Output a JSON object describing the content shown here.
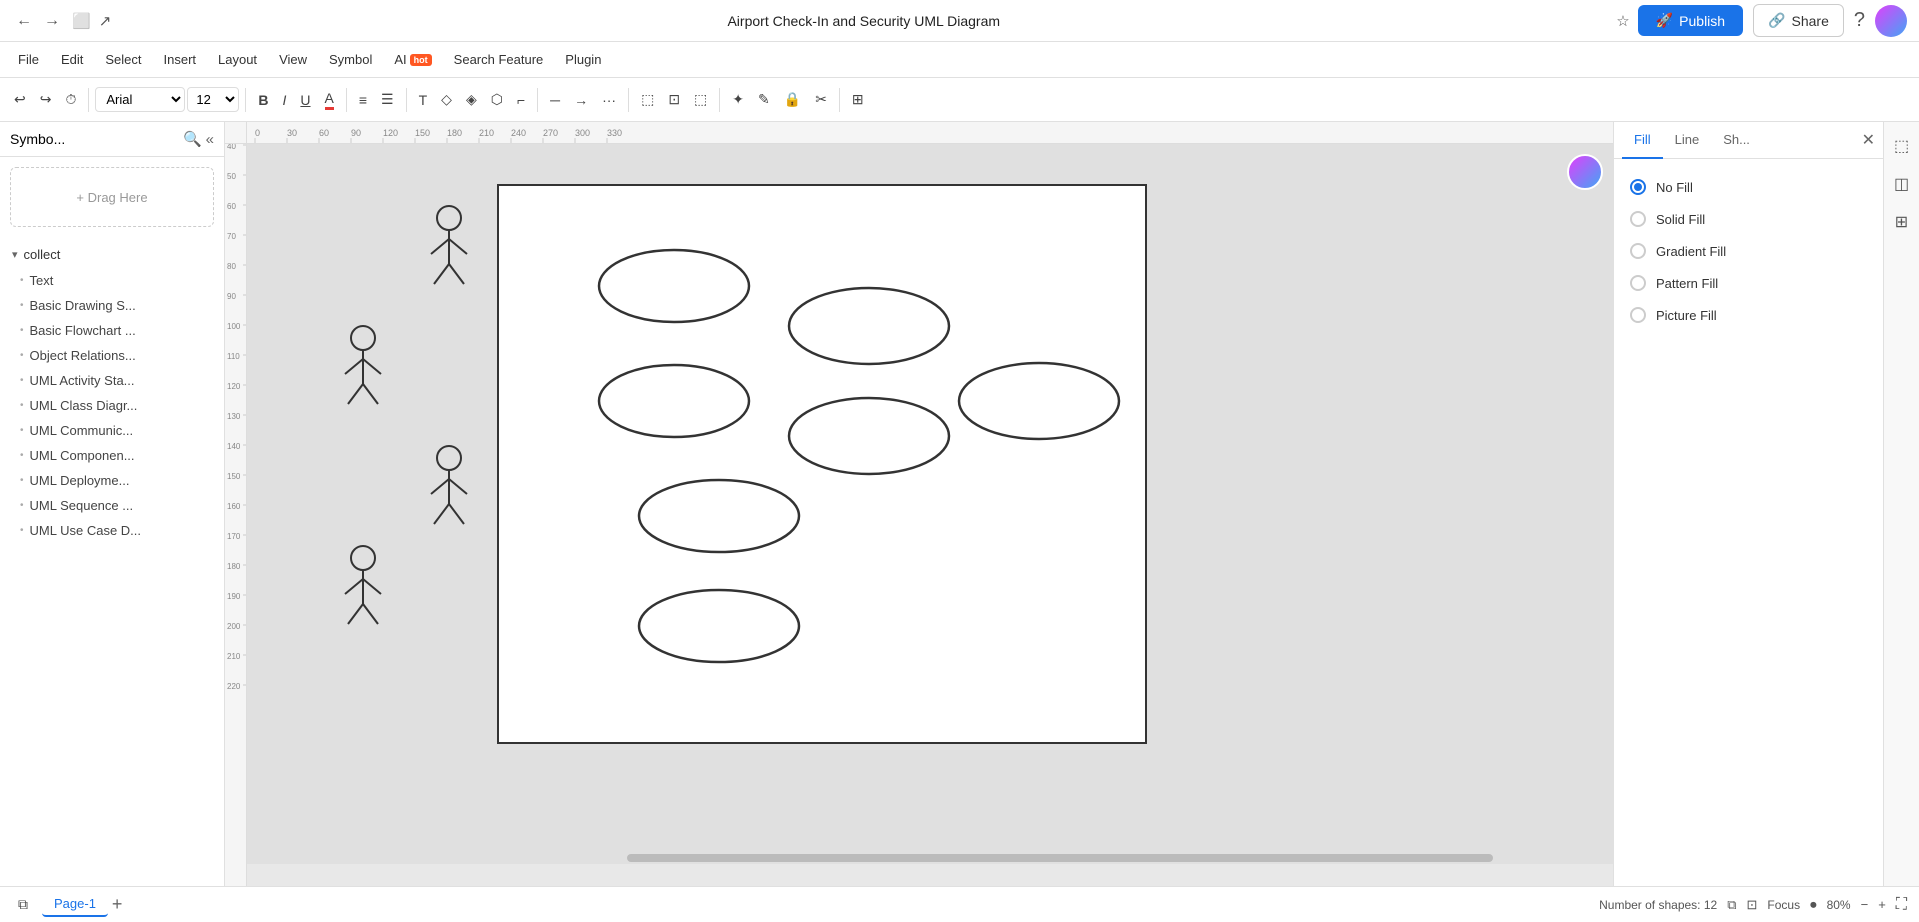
{
  "titleBar": {
    "back_icon": "←",
    "forward_icon": "→",
    "title": "Airport Check-In and Security UML Diagram",
    "tab_icon": "⬜",
    "external_icon": "↗",
    "star_icon": "☆",
    "publish_label": "Publish",
    "share_label": "Share",
    "help_icon": "?"
  },
  "menuBar": {
    "items": [
      "File",
      "Edit",
      "Select",
      "Insert",
      "Layout",
      "View",
      "Symbol",
      "AI",
      "Search Feature",
      "Plugin"
    ],
    "ai_hot_label": "hot"
  },
  "toolbar": {
    "undo": "↩",
    "redo": "↪",
    "history": "⏱",
    "font_family": "Arial",
    "font_size": "12",
    "bold": "B",
    "italic": "I",
    "underline": "U",
    "font_color": "A",
    "align": "≡",
    "align2": "☰",
    "text_t": "T",
    "shape": "◇",
    "line": "/",
    "connector": "⌐",
    "line_style": "─",
    "arrow": "→",
    "dots": "···",
    "container": "⬚",
    "edit2": "⬚",
    "page": "⬚",
    "lock": "🔒",
    "edit3": "✎",
    "table": "⊞"
  },
  "sidebar": {
    "title": "Symbo...",
    "search_icon": "🔍",
    "collapse_icon": "«",
    "drag_here": "+ Drag Here",
    "collect_group": "collect",
    "groups": [
      {
        "label": "Text",
        "bullet": "•"
      },
      {
        "label": "Basic Drawing S...",
        "bullet": "•"
      },
      {
        "label": "Basic Flowchart ...",
        "bullet": "•"
      },
      {
        "label": "Object Relations...",
        "bullet": "•"
      },
      {
        "label": "UML Activity Sta...",
        "bullet": "•"
      },
      {
        "label": "UML Class Diagr...",
        "bullet": "•"
      },
      {
        "label": "UML Communic...",
        "bullet": "•"
      },
      {
        "label": "UML Componen...",
        "bullet": "•"
      },
      {
        "label": "UML Deployme...",
        "bullet": "•"
      },
      {
        "label": "UML Sequence ...",
        "bullet": "•"
      },
      {
        "label": "UML Use Case D...",
        "bullet": "•"
      }
    ]
  },
  "rightPanel": {
    "tabs": [
      "Fill",
      "Line",
      "Sh..."
    ],
    "fill_options": [
      {
        "label": "No Fill",
        "selected": true
      },
      {
        "label": "Solid Fill",
        "selected": false
      },
      {
        "label": "Gradient Fill",
        "selected": false
      },
      {
        "label": "Pattern Fill",
        "selected": false
      },
      {
        "label": "Picture Fill",
        "selected": false
      }
    ]
  },
  "bottomBar": {
    "page_label": "Page-1",
    "shapes_count": "Number of shapes: 12",
    "focus_label": "Focus",
    "zoom_level": "80%"
  },
  "ruler": {
    "h_marks": [
      "0",
      "",
      "30",
      "",
      "60",
      "",
      "90",
      "",
      "120",
      "",
      "150",
      "",
      "180",
      "",
      "210",
      "",
      "240",
      "",
      "270",
      "",
      "300",
      "",
      ""
    ],
    "v_marks": [
      "40",
      "50",
      "60",
      "70",
      "80",
      "90",
      "100",
      "110",
      "120",
      "130",
      "140",
      "150",
      "160",
      "170",
      "180",
      "190",
      "200",
      "210",
      "220"
    ]
  }
}
